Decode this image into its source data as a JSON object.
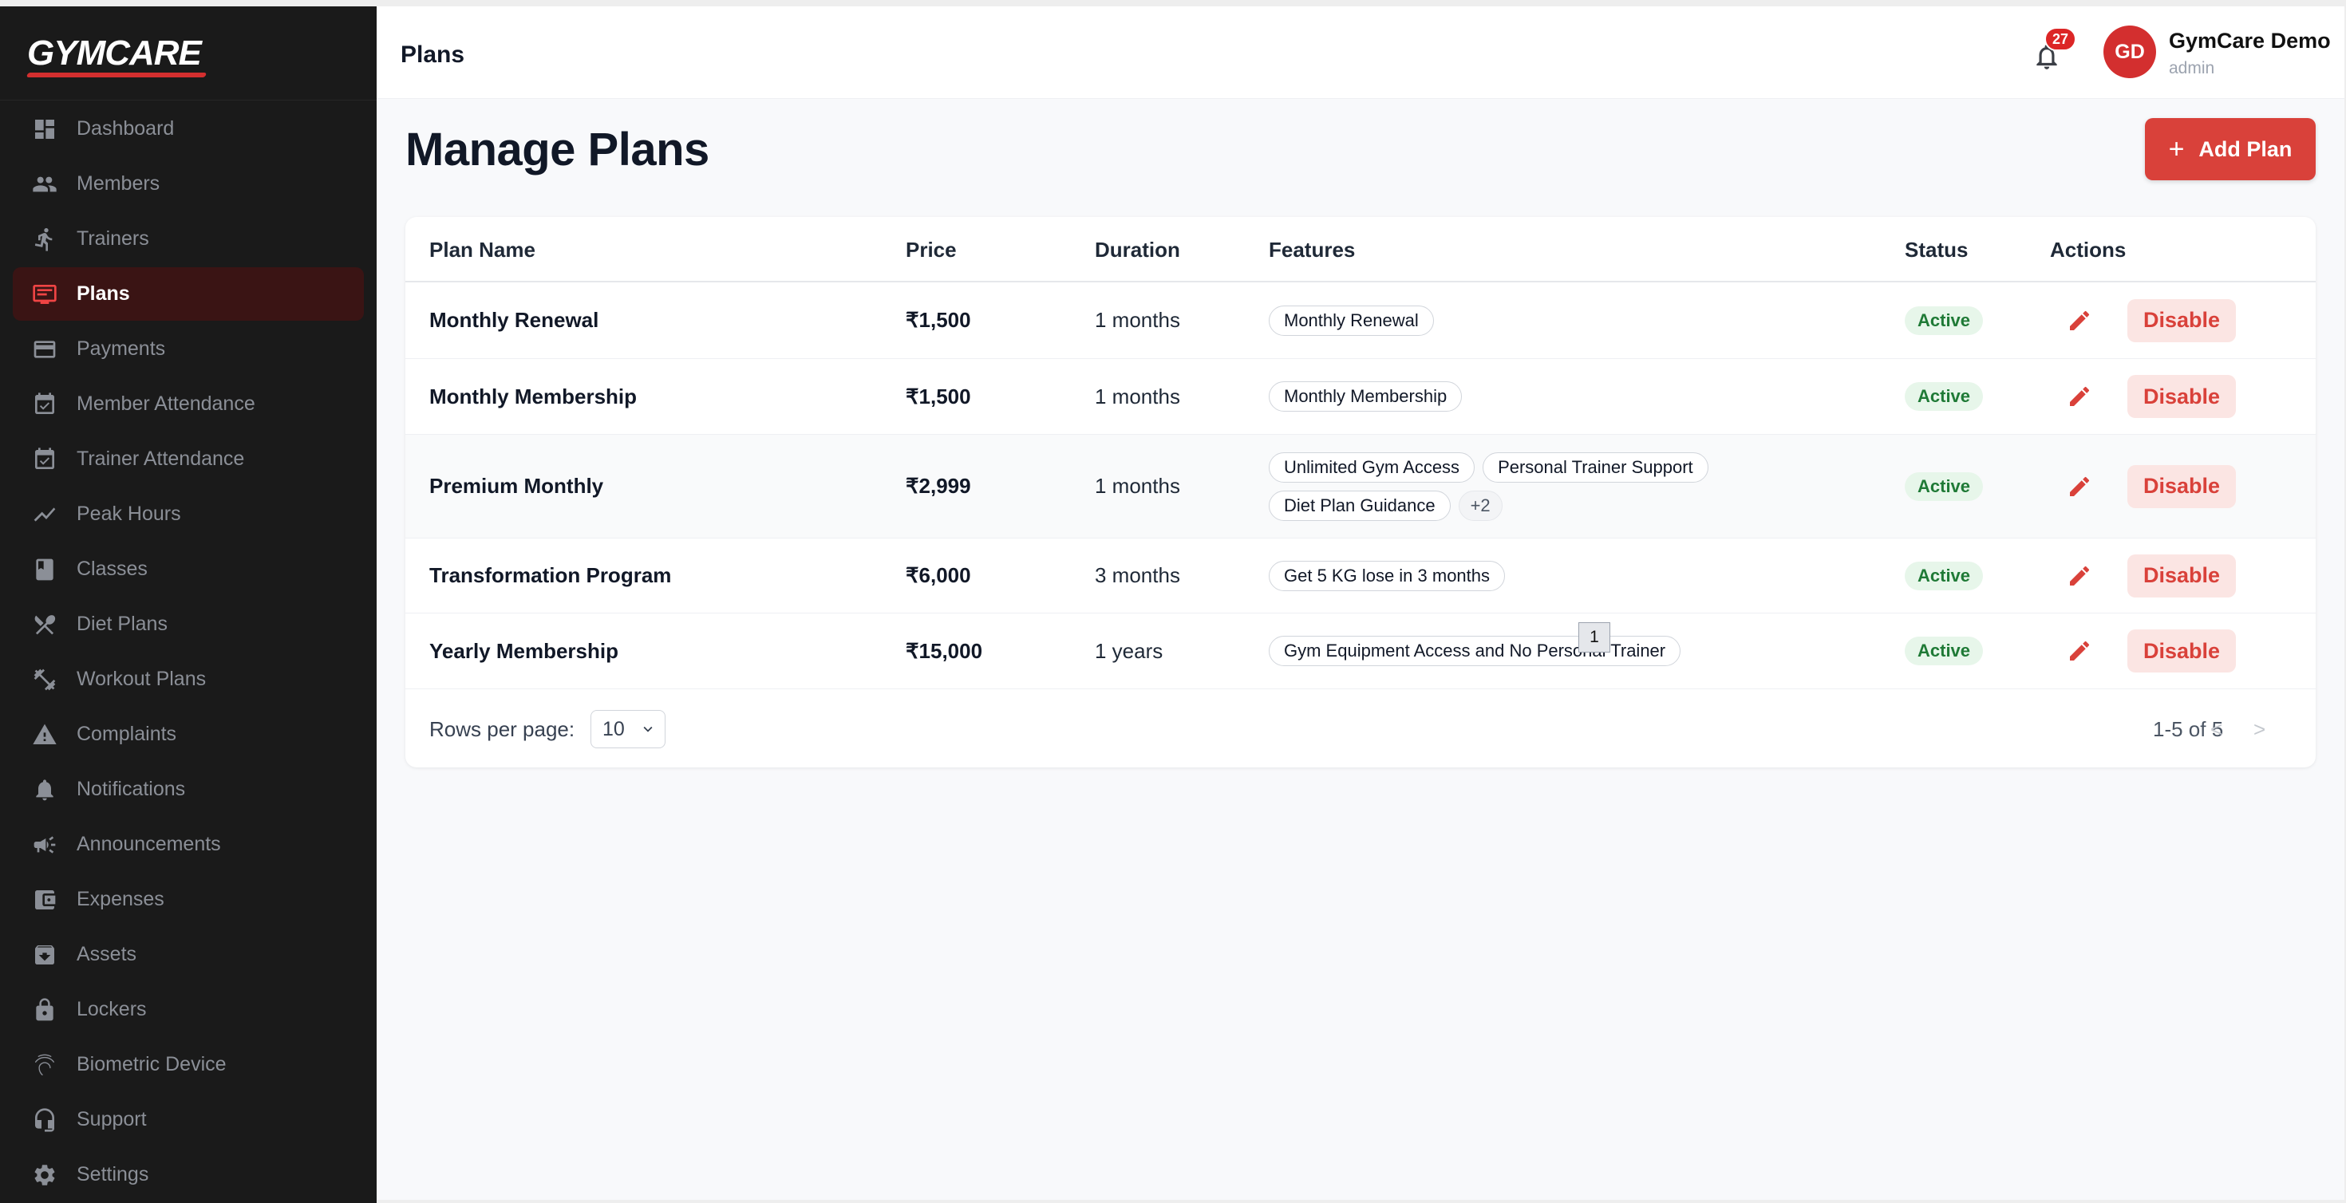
{
  "brand": {
    "logo_text": "GYMCARE"
  },
  "sidebar": {
    "items": [
      {
        "label": "Dashboard",
        "icon": "dashboard-icon",
        "active": false
      },
      {
        "label": "Members",
        "icon": "people-icon",
        "active": false
      },
      {
        "label": "Trainers",
        "icon": "runner-icon",
        "active": false
      },
      {
        "label": "Plans",
        "icon": "plans-icon",
        "active": true
      },
      {
        "label": "Payments",
        "icon": "credit-card-icon",
        "active": false
      },
      {
        "label": "Member Attendance",
        "icon": "calendar-check-icon",
        "active": false
      },
      {
        "label": "Trainer Attendance",
        "icon": "calendar-check-icon",
        "active": false
      },
      {
        "label": "Peak Hours",
        "icon": "chart-line-icon",
        "active": false
      },
      {
        "label": "Classes",
        "icon": "book-icon",
        "active": false
      },
      {
        "label": "Diet Plans",
        "icon": "utensils-icon",
        "active": false
      },
      {
        "label": "Workout Plans",
        "icon": "dumbbell-icon",
        "active": false
      },
      {
        "label": "Complaints",
        "icon": "warning-icon",
        "active": false
      },
      {
        "label": "Notifications",
        "icon": "bell-icon",
        "active": false
      },
      {
        "label": "Announcements",
        "icon": "megaphone-icon",
        "active": false
      },
      {
        "label": "Expenses",
        "icon": "wallet-icon",
        "active": false
      },
      {
        "label": "Assets",
        "icon": "archive-icon",
        "active": false
      },
      {
        "label": "Lockers",
        "icon": "lock-icon",
        "active": false
      },
      {
        "label": "Biometric Device",
        "icon": "fingerprint-icon",
        "active": false
      },
      {
        "label": "Support",
        "icon": "headset-icon",
        "active": false
      },
      {
        "label": "Settings",
        "icon": "gear-icon",
        "active": false
      }
    ]
  },
  "header": {
    "title": "Plans",
    "notifications_count": "27",
    "user": {
      "initials": "GD",
      "name": "GymCare Demo",
      "role": "admin"
    }
  },
  "main": {
    "title": "Manage Plans",
    "add_button_label": "Add Plan",
    "columns": [
      "Plan Name",
      "Price",
      "Duration",
      "Features",
      "Status",
      "Actions"
    ],
    "rows": [
      {
        "name": "Monthly Renewal",
        "price": "₹1,500",
        "duration": "1 months",
        "features": [
          "Monthly Renewal"
        ],
        "more": "",
        "status": "Active",
        "action": "Disable"
      },
      {
        "name": "Monthly Membership",
        "price": "₹1,500",
        "duration": "1 months",
        "features": [
          "Monthly Membership"
        ],
        "more": "",
        "status": "Active",
        "action": "Disable"
      },
      {
        "name": "Premium Monthly",
        "price": "₹2,999",
        "duration": "1 months",
        "features": [
          "Unlimited Gym Access",
          "Personal Trainer Support",
          "Diet Plan Guidance"
        ],
        "more": "+2",
        "status": "Active",
        "action": "Disable"
      },
      {
        "name": "Transformation Program",
        "price": "₹6,000",
        "duration": "3 months",
        "features": [
          "Get 5 KG lose in 3 months"
        ],
        "more": "",
        "status": "Active",
        "action": "Disable"
      },
      {
        "name": "Yearly Membership",
        "price": "₹15,000",
        "duration": "1 years",
        "features": [
          "Gym Equipment Access and No Personal Trainer"
        ],
        "more": "",
        "status": "Active",
        "action": "Disable"
      }
    ],
    "pagination": {
      "rows_per_page_label": "Rows per page:",
      "rows_per_page": "10",
      "range": "1-5 of 5",
      "prev": "<",
      "next": ">"
    },
    "tooltip": "1"
  },
  "colors": {
    "accent": "#d9413a",
    "sidebar_bg": "#1a1a1a",
    "active_bg": "#3a1414",
    "status_green": "#1f7a36"
  }
}
